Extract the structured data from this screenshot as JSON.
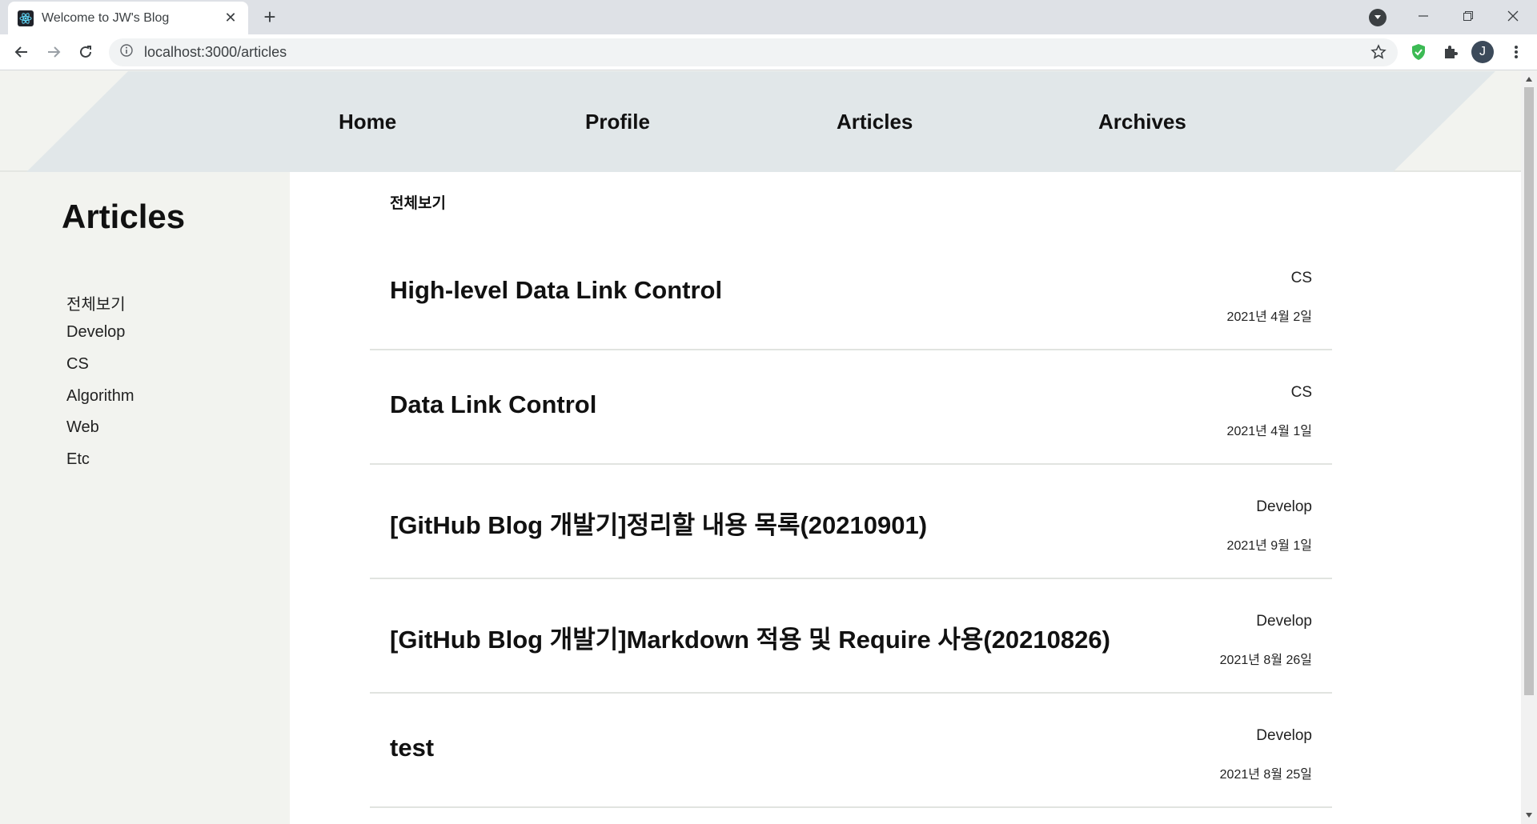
{
  "browser": {
    "tab_title": "Welcome to JW's Blog",
    "url": "localhost:3000/articles",
    "profile_initial": "J"
  },
  "nav": {
    "home": "Home",
    "profile": "Profile",
    "articles": "Articles",
    "archives": "Archives"
  },
  "sidebar": {
    "title": "Articles",
    "items": [
      "전체보기",
      "Develop",
      "CS",
      "Algorithm",
      "Web",
      "Etc"
    ]
  },
  "main": {
    "filter_label": "전체보기",
    "articles": [
      {
        "title": "High-level Data Link Control",
        "category": "CS",
        "date": "2021년 4월 2일"
      },
      {
        "title": "Data Link Control",
        "category": "CS",
        "date": "2021년 4월 1일"
      },
      {
        "title": "[GitHub Blog 개발기]정리할 내용 목록(20210901)",
        "category": "Develop",
        "date": "2021년 9월 1일"
      },
      {
        "title": "[GitHub Blog 개발기]Markdown 적용 및 Require 사용(20210826)",
        "category": "Develop",
        "date": "2021년 8월 26일"
      },
      {
        "title": "test",
        "category": "Develop",
        "date": "2021년 8월 25일"
      }
    ]
  },
  "colors": {
    "header_band": "#e1e7e9",
    "page_bg": "#f2f3ef",
    "content_bg": "#ffffff",
    "shield": "#3cba54"
  }
}
